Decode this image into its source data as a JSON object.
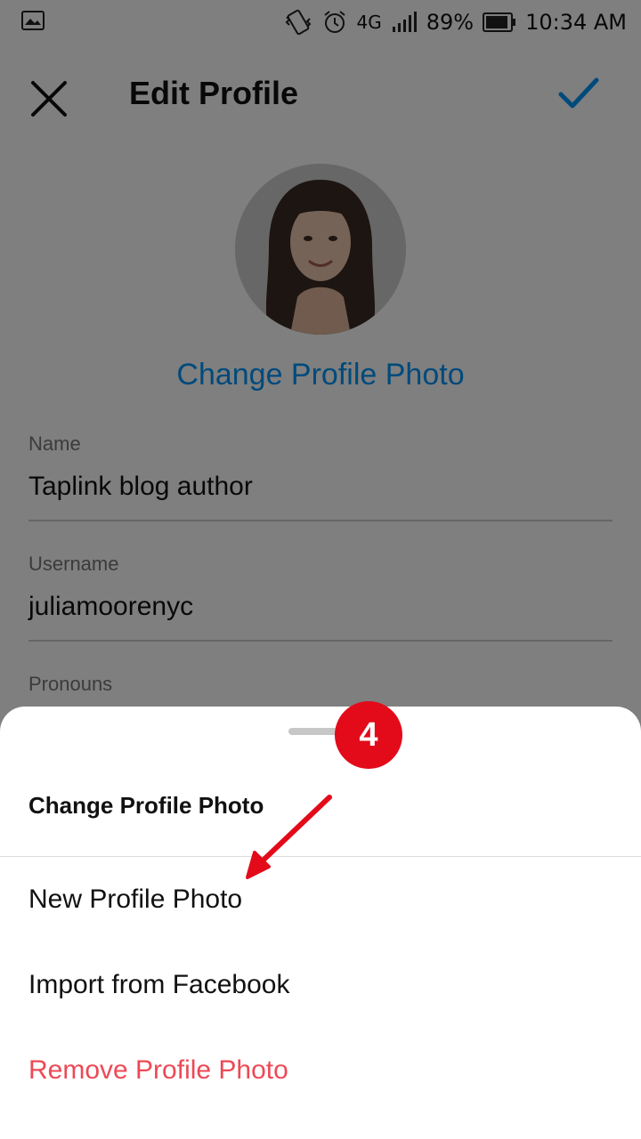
{
  "status_bar": {
    "network": "4G",
    "battery": "89%",
    "time": "10:34 AM"
  },
  "header": {
    "title": "Edit Profile"
  },
  "profile": {
    "change_photo_label": "Change Profile Photo"
  },
  "fields": [
    {
      "label": "Name",
      "value": "Taplink blog author"
    },
    {
      "label": "Username",
      "value": "juliamoorenyc"
    },
    {
      "label": "Pronouns",
      "value": ""
    }
  ],
  "sheet": {
    "title": "Change Profile Photo",
    "options": [
      {
        "label": "New Profile Photo"
      },
      {
        "label": "Import from Facebook"
      },
      {
        "label": "Remove Profile Photo"
      }
    ]
  },
  "annotation": {
    "step_number": "4",
    "color": "#e30b1a"
  },
  "colors": {
    "accent": "#0095f6",
    "destructive": "#ed4956"
  }
}
